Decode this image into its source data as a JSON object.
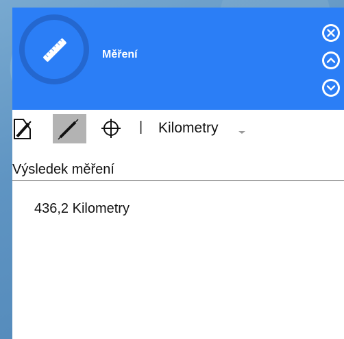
{
  "header": {
    "title": "Měření",
    "accent_color": "#2b7ef6",
    "icon": "ruler-icon",
    "close_icon": "close-icon",
    "collapse_icon": "chevron-up-icon",
    "expand_icon": "chevron-down-icon"
  },
  "toolbar": {
    "tools": [
      {
        "name": "area-measure-icon",
        "active": false
      },
      {
        "name": "distance-measure-icon",
        "active": true
      },
      {
        "name": "location-crosshair-icon",
        "active": false
      }
    ],
    "separator": "|",
    "unit_selected": "Kilometry"
  },
  "result": {
    "title": "Výsledek měření",
    "value": "436,2 Kilometry"
  }
}
